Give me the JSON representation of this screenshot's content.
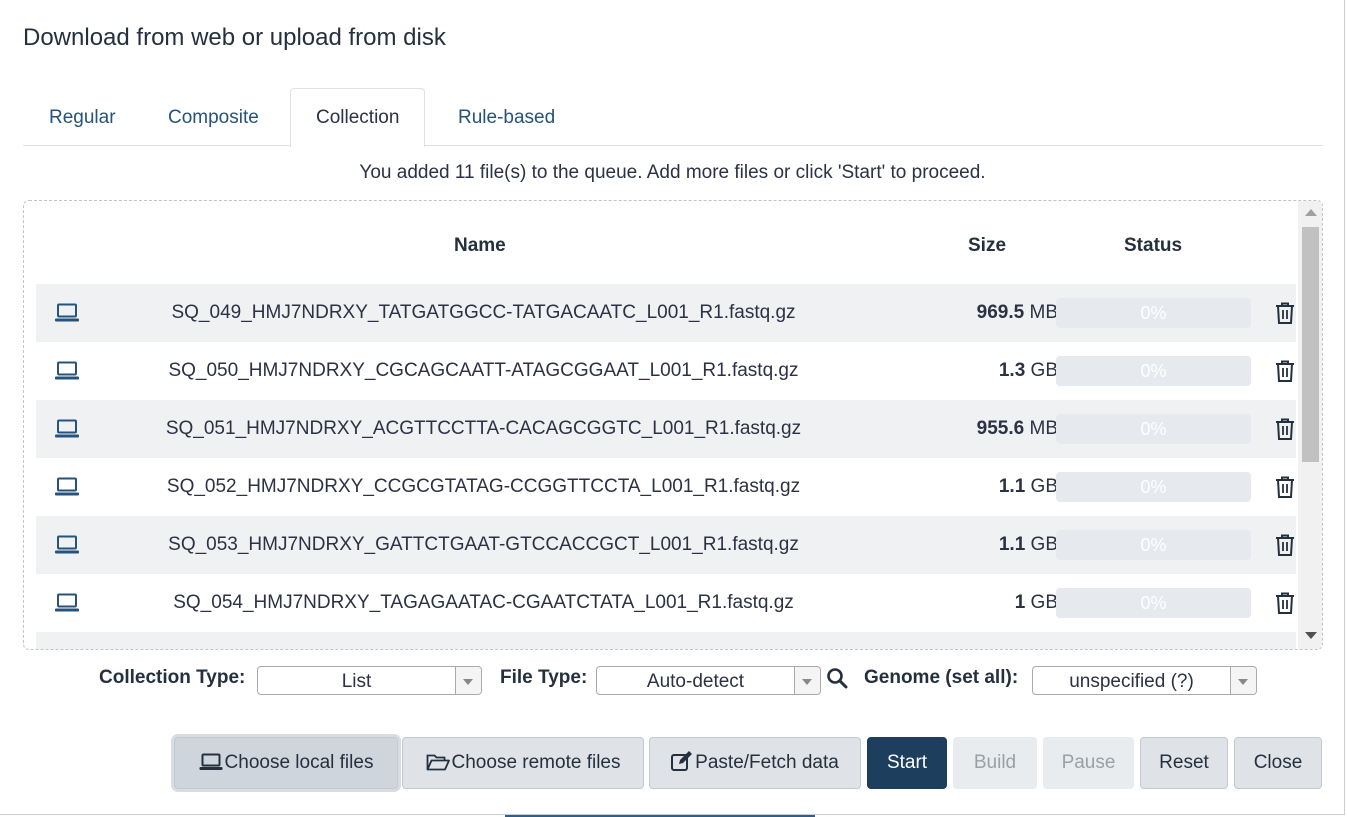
{
  "dialog": {
    "title": "Download from web or upload from disk"
  },
  "tabs": [
    {
      "label": "Regular",
      "active": false
    },
    {
      "label": "Composite",
      "active": false
    },
    {
      "label": "Collection",
      "active": true
    },
    {
      "label": "Rule-based",
      "active": false
    }
  ],
  "helper_text": "You added 11 file(s) to the queue. Add more files or click 'Start' to proceed.",
  "table": {
    "headers": {
      "name": "Name",
      "size": "Size",
      "status": "Status"
    },
    "rows": [
      {
        "name": "SQ_049_HMJ7NDRXY_TATGATGGCC-TATGACAATC_L001_R1.fastq.gz",
        "size_value": "969.5",
        "size_unit": "MB",
        "status": "0%",
        "icon": "laptop-icon"
      },
      {
        "name": "SQ_050_HMJ7NDRXY_CGCAGCAATT-ATAGCGGAAT_L001_R1.fastq.gz",
        "size_value": "1.3",
        "size_unit": "GB",
        "status": "0%",
        "icon": "laptop-icon"
      },
      {
        "name": "SQ_051_HMJ7NDRXY_ACGTTCCTTA-CACAGCGGTC_L001_R1.fastq.gz",
        "size_value": "955.6",
        "size_unit": "MB",
        "status": "0%",
        "icon": "laptop-icon"
      },
      {
        "name": "SQ_052_HMJ7NDRXY_CCGCGTATAG-CCGGTTCCTA_L001_R1.fastq.gz",
        "size_value": "1.1",
        "size_unit": "GB",
        "status": "0%",
        "icon": "laptop-icon"
      },
      {
        "name": "SQ_053_HMJ7NDRXY_GATTCTGAAT-GTCCACCGCT_L001_R1.fastq.gz",
        "size_value": "1.1",
        "size_unit": "GB",
        "status": "0%",
        "icon": "laptop-icon"
      },
      {
        "name": "SQ_054_HMJ7NDRXY_TAGAGAATAC-CGAATCTATA_L001_R1.fastq.gz",
        "size_value": "1",
        "size_unit": "GB",
        "status": "0%",
        "icon": "laptop-icon"
      }
    ]
  },
  "options": {
    "collection_type_label": "Collection Type:",
    "collection_type_value": "List",
    "file_type_label": "File Type:",
    "file_type_value": "Auto-detect",
    "genome_label": "Genome (set all):",
    "genome_value": "unspecified (?)"
  },
  "buttons": {
    "choose_local": "Choose local files",
    "choose_remote": "Choose remote files",
    "paste_fetch": "Paste/Fetch data",
    "start": "Start",
    "build": "Build",
    "pause": "Pause",
    "reset": "Reset",
    "close": "Close"
  },
  "colors": {
    "primary": "#1e3e5e",
    "link": "#25537b",
    "row_alt": "#f0f1f3"
  }
}
